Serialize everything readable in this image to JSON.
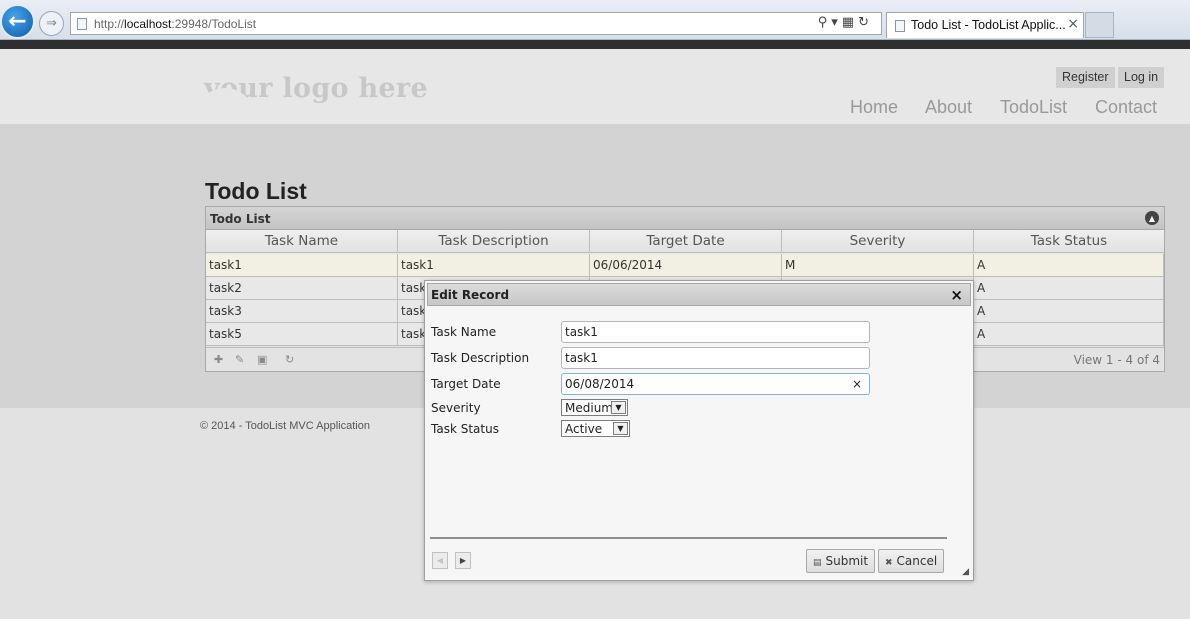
{
  "browser": {
    "url_prefix": "http://",
    "url_host": "localhost",
    "url_rest": ":29948/TodoList",
    "tab_title": "Todo List - TodoList Applic...",
    "tab_close": "×"
  },
  "site": {
    "logo": "your logo here",
    "auth": {
      "register": "Register",
      "login": "Log in"
    },
    "nav": {
      "home": "Home",
      "about": "About",
      "todolist": "TodoList",
      "contact": "Contact"
    },
    "page_title": "Todo List",
    "footer": "© 2014 - TodoList MVC Application"
  },
  "grid": {
    "caption": "Todo List",
    "columns": [
      "Task Name",
      "Task Description",
      "Target Date",
      "Severity",
      "Task Status"
    ],
    "rows": [
      [
        "task1",
        "task1",
        "06/06/2014",
        "M",
        "A"
      ],
      [
        "task2",
        "task",
        "",
        "",
        "A"
      ],
      [
        "task3",
        "task",
        "",
        "",
        "A"
      ],
      [
        "task5",
        "task",
        "",
        "",
        "A"
      ]
    ],
    "view_text": "View 1 - 4 of 4"
  },
  "dialog": {
    "title": "Edit Record",
    "close": "×",
    "labels": {
      "task_name": "Task Name",
      "task_description": "Task Description",
      "target_date": "Target Date",
      "severity": "Severity",
      "task_status": "Task Status"
    },
    "values": {
      "task_name": "task1",
      "task_description": "task1",
      "target_date": "06/08/2014",
      "severity": "Medium",
      "task_status": "Active"
    },
    "clear": "×",
    "submit": "Submit",
    "cancel": "Cancel"
  }
}
